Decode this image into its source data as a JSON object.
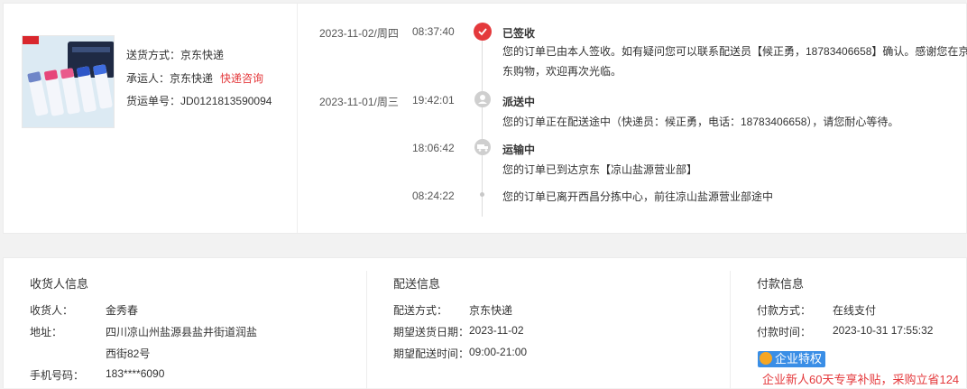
{
  "shipment": {
    "method_label": "送货方式：",
    "method_value": "京东快递",
    "carrier_label": "承运人：",
    "carrier_value": "京东快递",
    "consult_link": "快递咨询",
    "tracking_label": "货运单号：",
    "tracking_value": "JD0121813590094"
  },
  "timeline": [
    {
      "date": "2023-11-02/周四",
      "time": "08:37:40",
      "status": "已签收",
      "desc": "您的订单已由本人签收。如有疑问您可以联系配送员【候正勇，18783406658】确认。感谢您在京东购物，欢迎再次光临。",
      "icon": "check-icon"
    },
    {
      "date": "2023-11-01/周三",
      "time": "19:42:01",
      "status": "派送中",
      "desc": "您的订单正在配送途中（快递员：候正勇，电话：18783406658），请您耐心等待。",
      "icon": "delivery-person-icon"
    },
    {
      "date": "",
      "time": "18:06:42",
      "status": "运输中",
      "desc": "您的订单已到达京东【凉山盐源营业部】",
      "icon": "truck-icon"
    },
    {
      "date": "",
      "time": "08:24:22",
      "status": "",
      "desc": "您的订单已离开西昌分拣中心，前往凉山盐源营业部途中",
      "icon": "dot-icon"
    }
  ],
  "receiver": {
    "title": "收货人信息",
    "name_label": "收货人：",
    "name_value": "金秀春",
    "address_label": "地址：",
    "address_line1": "四川凉山州盐源县盐井街道润盐",
    "address_line2": "西街82号",
    "phone_label": "手机号码：",
    "phone_value": "183****6090"
  },
  "delivery": {
    "title": "配送信息",
    "method_label": "配送方式：",
    "method_value": "京东快递",
    "date_label": "期望送货日期：",
    "date_value": "2023-11-02",
    "time_label": "期望配送时间：",
    "time_value": "09:00-21:00"
  },
  "payment": {
    "title": "付款信息",
    "method_label": "付款方式：",
    "method_value": "在线支付",
    "time_label": "付款时间：",
    "time_value": "2023-10-31 17:55:32",
    "badge": "企业特权",
    "promo": "企业新人60天专享补贴，采购立省124"
  },
  "colors": {
    "accent_red": "#e4393c",
    "badge_blue": "#3a8ee6",
    "grey_node": "#cfcfcf"
  }
}
